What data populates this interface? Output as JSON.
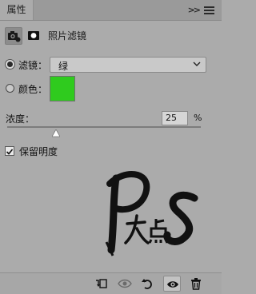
{
  "tabs": {
    "properties": "属性"
  },
  "header": {
    "title": "照片滤镜"
  },
  "filter": {
    "label": "滤镜：",
    "value": "绿",
    "selected": true
  },
  "color": {
    "label": "颜色：",
    "swatch_hex": "#2fcb1e",
    "selected": false
  },
  "density": {
    "label": "浓度：",
    "value": "25",
    "unit": "%",
    "percent": 25
  },
  "preserve": {
    "label": "保留明度",
    "checked": true
  },
  "watermark": {
    "text": "PS大点"
  },
  "bottom_icons": [
    "clip-to-layer-icon",
    "view-previous-icon",
    "reset-icon",
    "visibility-eye-icon",
    "trash-icon"
  ]
}
